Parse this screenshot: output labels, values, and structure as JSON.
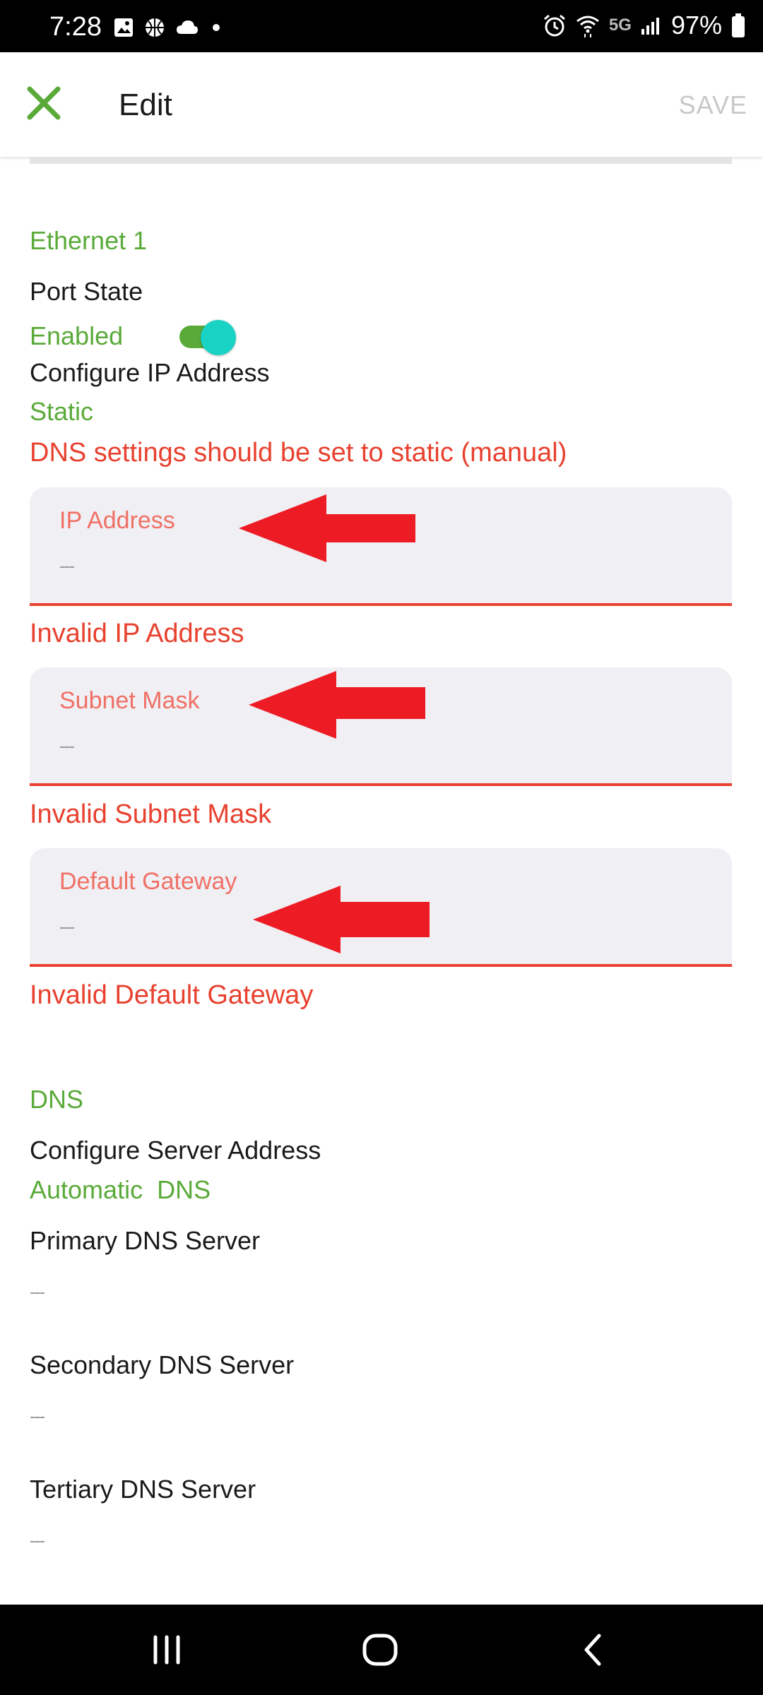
{
  "status_bar": {
    "time": "7:28",
    "network": "5G",
    "battery": "97%",
    "icons_left": [
      "image-icon",
      "basketball-icon",
      "cloud-icon",
      "dot-icon"
    ],
    "icons_right": [
      "alarm-icon",
      "wifi-icon",
      "signal-icon",
      "battery-icon"
    ]
  },
  "app_bar": {
    "title": "Edit",
    "save_label": "SAVE",
    "close_icon": "close-icon",
    "accent": "#5aaa3a"
  },
  "ethernet": {
    "section_title": "Ethernet 1",
    "port_state_label": "Port State",
    "port_state_value": "Enabled",
    "port_state_on": true,
    "configure_ip_label": "Configure IP Address",
    "configure_ip_value": "Static",
    "dns_warning": "DNS settings should be set to static (manual)"
  },
  "fields": [
    {
      "label": "IP Address",
      "value": "---",
      "error": "Invalid IP Address"
    },
    {
      "label": "Subnet Mask",
      "value": "---",
      "error": "Invalid Subnet Mask"
    },
    {
      "label": "Default Gateway",
      "value": "---",
      "error": "Invalid Default Gateway"
    }
  ],
  "dns": {
    "section_title": "DNS",
    "configure_label": "Configure Server Address",
    "configure_value": "Automatic  DNS",
    "primary_label": "Primary DNS Server",
    "primary_value": "---",
    "secondary_label": "Secondary DNS Server",
    "secondary_value": "---",
    "tertiary_label": "Tertiary DNS Server",
    "tertiary_value": "---"
  },
  "colors": {
    "green": "#5aaa3a",
    "error_red": "#e8412f",
    "arrow_red": "#ed1c24",
    "toggle_thumb": "#19d3c5"
  },
  "nav_bar": {
    "buttons": [
      "recent-apps-icon",
      "home-icon",
      "back-icon"
    ]
  }
}
